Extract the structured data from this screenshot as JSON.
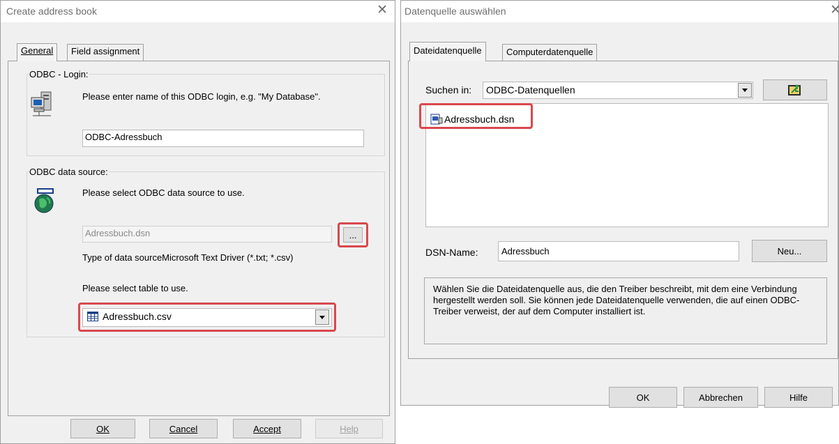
{
  "left_dialog": {
    "title": "Create address book",
    "tabs": [
      {
        "label": "General"
      },
      {
        "label": "Field assignment"
      }
    ],
    "login_group": {
      "legend": "ODBC - Login:",
      "prompt": "Please enter name of this ODBC login, e.g. \"My Database\".",
      "value": "ODBC-Adressbuch"
    },
    "datasource_group": {
      "legend": "ODBC data source:",
      "prompt": "Please select ODBC data source to use.",
      "source_value": "Adressbuch.dsn",
      "browse_label": "...",
      "type_text": "Type of data sourceMicrosoft Text Driver (*.txt; *.csv)",
      "table_prompt": "Please select table to use.",
      "table_value": "Adressbuch.csv"
    },
    "buttons": {
      "ok": "OK",
      "cancel": "Cancel",
      "accept": "Accept",
      "help": "Help"
    }
  },
  "right_dialog": {
    "title": "Datenquelle auswählen",
    "tabs": [
      {
        "label": "Dateidatenquelle"
      },
      {
        "label": "Computerdatenquelle"
      }
    ],
    "search_label": "Suchen in:",
    "search_value": "ODBC-Datenquellen",
    "files": [
      {
        "name": "Adressbuch.dsn"
      }
    ],
    "dsn_label": "DSN-Name:",
    "dsn_value": "Adressbuch",
    "new_button": "Neu...",
    "info_text": "Wählen Sie die Dateidatenquelle aus, die den Treiber beschreibt, mit dem eine Verbindung hergestellt werden soll. Sie können jede Dateidatenquelle verwenden, die auf einen ODBC-Treiber verweist, der auf dem Computer installiert ist.",
    "buttons": {
      "ok": "OK",
      "cancel": "Abbrechen",
      "help": "Hilfe"
    }
  },
  "colors": {
    "highlight": "#d9484e",
    "dialog_bg": "#f0f0f0"
  },
  "icons": [
    "close-icon",
    "computer-network-icon",
    "globe-datasource-icon",
    "table-icon",
    "dsn-file-icon",
    "folder-up-icon",
    "dropdown-arrow-icon"
  ]
}
